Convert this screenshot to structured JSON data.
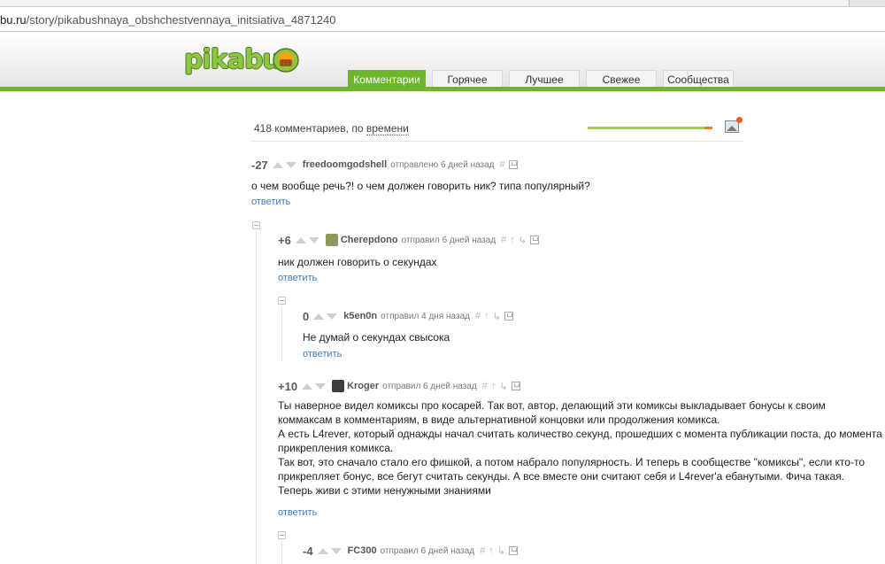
{
  "browser": {
    "url_host": "bu.ru",
    "url_path": "/story/pikabushnaya_obshchestvennaya_initsiativa_4871240"
  },
  "site": {
    "logo_text": "pikabu",
    "brand_color": "#6bb62a"
  },
  "tabs": [
    {
      "label": "Комментарии",
      "active": true
    },
    {
      "label": "Горячее",
      "active": false
    },
    {
      "label": "Лучшее",
      "active": false
    },
    {
      "label": "Свежее",
      "active": false
    },
    {
      "label": "Сообщества",
      "active": false
    }
  ],
  "toolbar": {
    "count_prefix": "418 комментариев, по",
    "sort_label": "времени"
  },
  "comments": [
    {
      "rating": "-27",
      "author": "freedoomgodshell",
      "meta": "отправлено 6 дней назад",
      "text": "о чем вообще речь?! о чем должен говорить ник? типа популярный?",
      "reply": "ответить"
    },
    {
      "rating": "+6",
      "author": "Cherepdono",
      "meta": "отправил 6 дней назад",
      "text": "ник должен говорить о секундах",
      "reply": "ответить"
    },
    {
      "rating": "0",
      "author": "k5en0n",
      "meta": "отправил 4 дня назад",
      "text": "Не думай о секундах свысока",
      "reply": "ответить"
    },
    {
      "rating": "+10",
      "author": "Kroger",
      "meta": "отправил 6 дней назад",
      "text_lines": [
        "Ты наверное видел комиксы про косарей. Так вот, автор, делающий эти комиксы выкладывает бонусы к своим",
        "коммаксам в комментариям, в виде альтернативной концовки или продолжения комикса.",
        "А есть L4rever, который однажды начал считать количество секунд, прошедших с момента публикации поста, до момента",
        "прикрепления комикса.",
        "Так вот, это сначало стало его фишкой, а потом набрало популярность. И теперь в сообществе \"комиксы\", если кто-то",
        "прикрепляет бонус, все бегут считать секунды. А все вместе они считают себя и L4rever'а ебанутыми. Фича такая.",
        "Теперь живи с этими ненужными знаниями"
      ],
      "reply": "ответить"
    },
    {
      "rating": "-4",
      "author": "FC300",
      "meta": "отправил 6 дней назад"
    }
  ]
}
